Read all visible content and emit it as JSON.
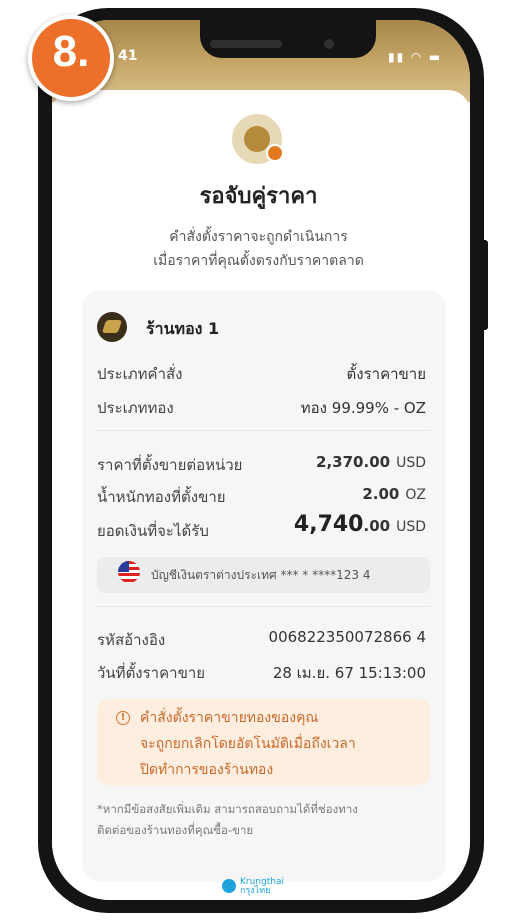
{
  "step_badge": "8.",
  "status_bar": {
    "time": "41"
  },
  "header": {
    "title": "รอจับคู่ราคา",
    "subtitle_line1": "คำสั่งตั้งราคาจะถูกดำเนินการ",
    "subtitle_line2": "เมื่อราคาที่คุณตั้งตรงกับราคาตลาด"
  },
  "shop": {
    "name": "ร้านทอง 1"
  },
  "details": [
    {
      "label": "ประเภทคำสั่ง",
      "value": "ตั้งราคาขาย"
    },
    {
      "label": "ประเภททอง",
      "value": "ทอง 99.99% - OZ"
    }
  ],
  "pricing": [
    {
      "label": "ราคาที่ตั้งขายต่อหน่วย",
      "value": "2,370.00",
      "unit": "USD"
    },
    {
      "label": "น้ำหนักทองที่ตั้งขาย",
      "value": "2.00",
      "unit": "OZ"
    },
    {
      "label": "ยอดเงินที่จะได้รับ",
      "value": "4,740",
      "value_decimals": ".00",
      "unit": "USD"
    }
  ],
  "account": {
    "text": "บัญชีเงินตราต่างประเทศ *** * ****123 4"
  },
  "reference": [
    {
      "label": "รหัสอ้างอิง",
      "value": "006822350072866 4"
    },
    {
      "label": "วันที่ตั้งราคาขาย",
      "value": "28 เม.ย. 67 15:13:00"
    }
  ],
  "warning": {
    "line1": "คำสั่งตั้งราคาขายทองของคุณ",
    "line2": "จะถูกยกเลิกโดยอัตโนมัติเมื่อถึงเวลา",
    "line3": "ปิดทำการของร้านทอง"
  },
  "note": {
    "line1": "*หากมีข้อสงสัยเพิ่มเติม สามารถสอบถามได้ที่ช่องทาง",
    "line2": "ติดต่อของร้านทองที่คุณซื้อ-ขาย"
  },
  "footer": {
    "brand_line1": "Krungthai",
    "brand_line2": "กรุงไทย"
  },
  "colors": {
    "accent": "#ec6f2a",
    "gold": "#b58a3b",
    "warning_text": "#c9692a"
  }
}
